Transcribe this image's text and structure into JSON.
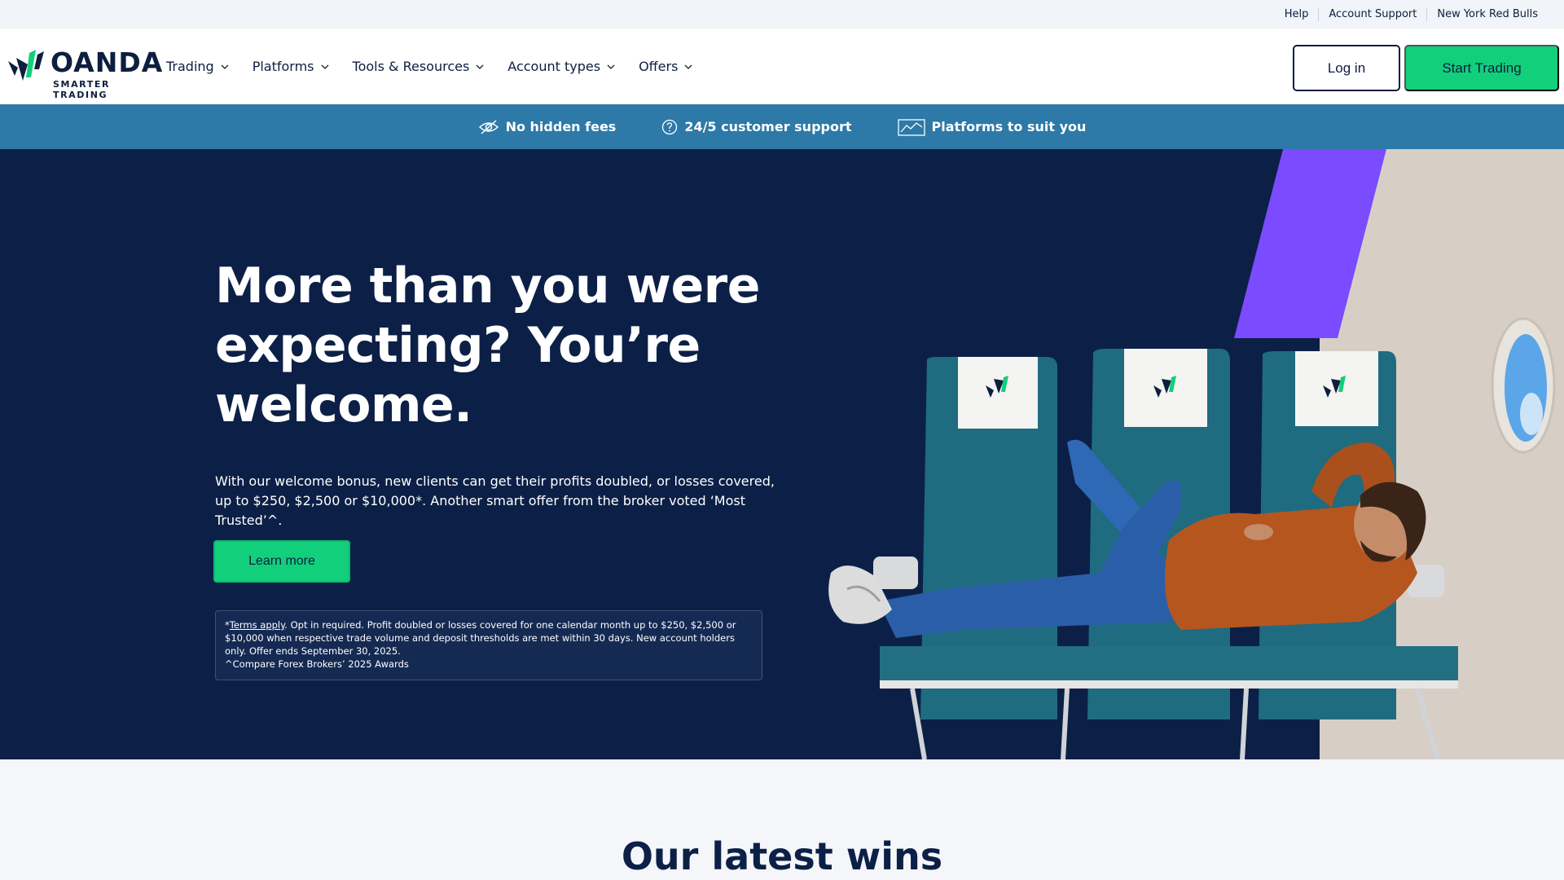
{
  "utility": {
    "links": [
      "Help",
      "Account Support",
      "New York Red Bulls"
    ]
  },
  "header": {
    "logo_text": "OANDA",
    "logo_tagline": "SMARTER TRADING",
    "nav": [
      "Trading",
      "Platforms",
      "Tools & Resources",
      "Account types",
      "Offers"
    ],
    "login_label": "Log in",
    "start_label": "Start Trading"
  },
  "benefits": [
    "No hidden fees",
    "24/5 customer support",
    "Platforms to suit you"
  ],
  "hero": {
    "title": "More than you were expecting? You’re welcome.",
    "text": "With our welcome bonus, new clients can get their profits doubled, or losses covered, up to $250, $2,500 or $10,000*. Another smart offer from the broker voted ‘Most Trusted’^.",
    "button_label": "Learn more",
    "disclaimer_prefix": "*",
    "disclaimer_link": "Terms apply",
    "disclaimer_body": ". Opt in required. Profit doubled or losses covered for one calendar month up to $250, $2,500 or $10,000 when respective trade volume and deposit thresholds are met within 30 days. New account holders only. Offer ends September 30, 2025.",
    "disclaimer_award": "^Compare Forex Brokers’ 2025 Awards"
  },
  "wins": {
    "title": "Our latest wins"
  },
  "colors": {
    "navy": "#0c2047",
    "green": "#12cf7b",
    "strip_blue": "#2d79a8",
    "purple": "#7b4bff",
    "seat_teal": "#1f6b7f",
    "sweater": "#b5561f",
    "jeans": "#2a5ea8"
  }
}
